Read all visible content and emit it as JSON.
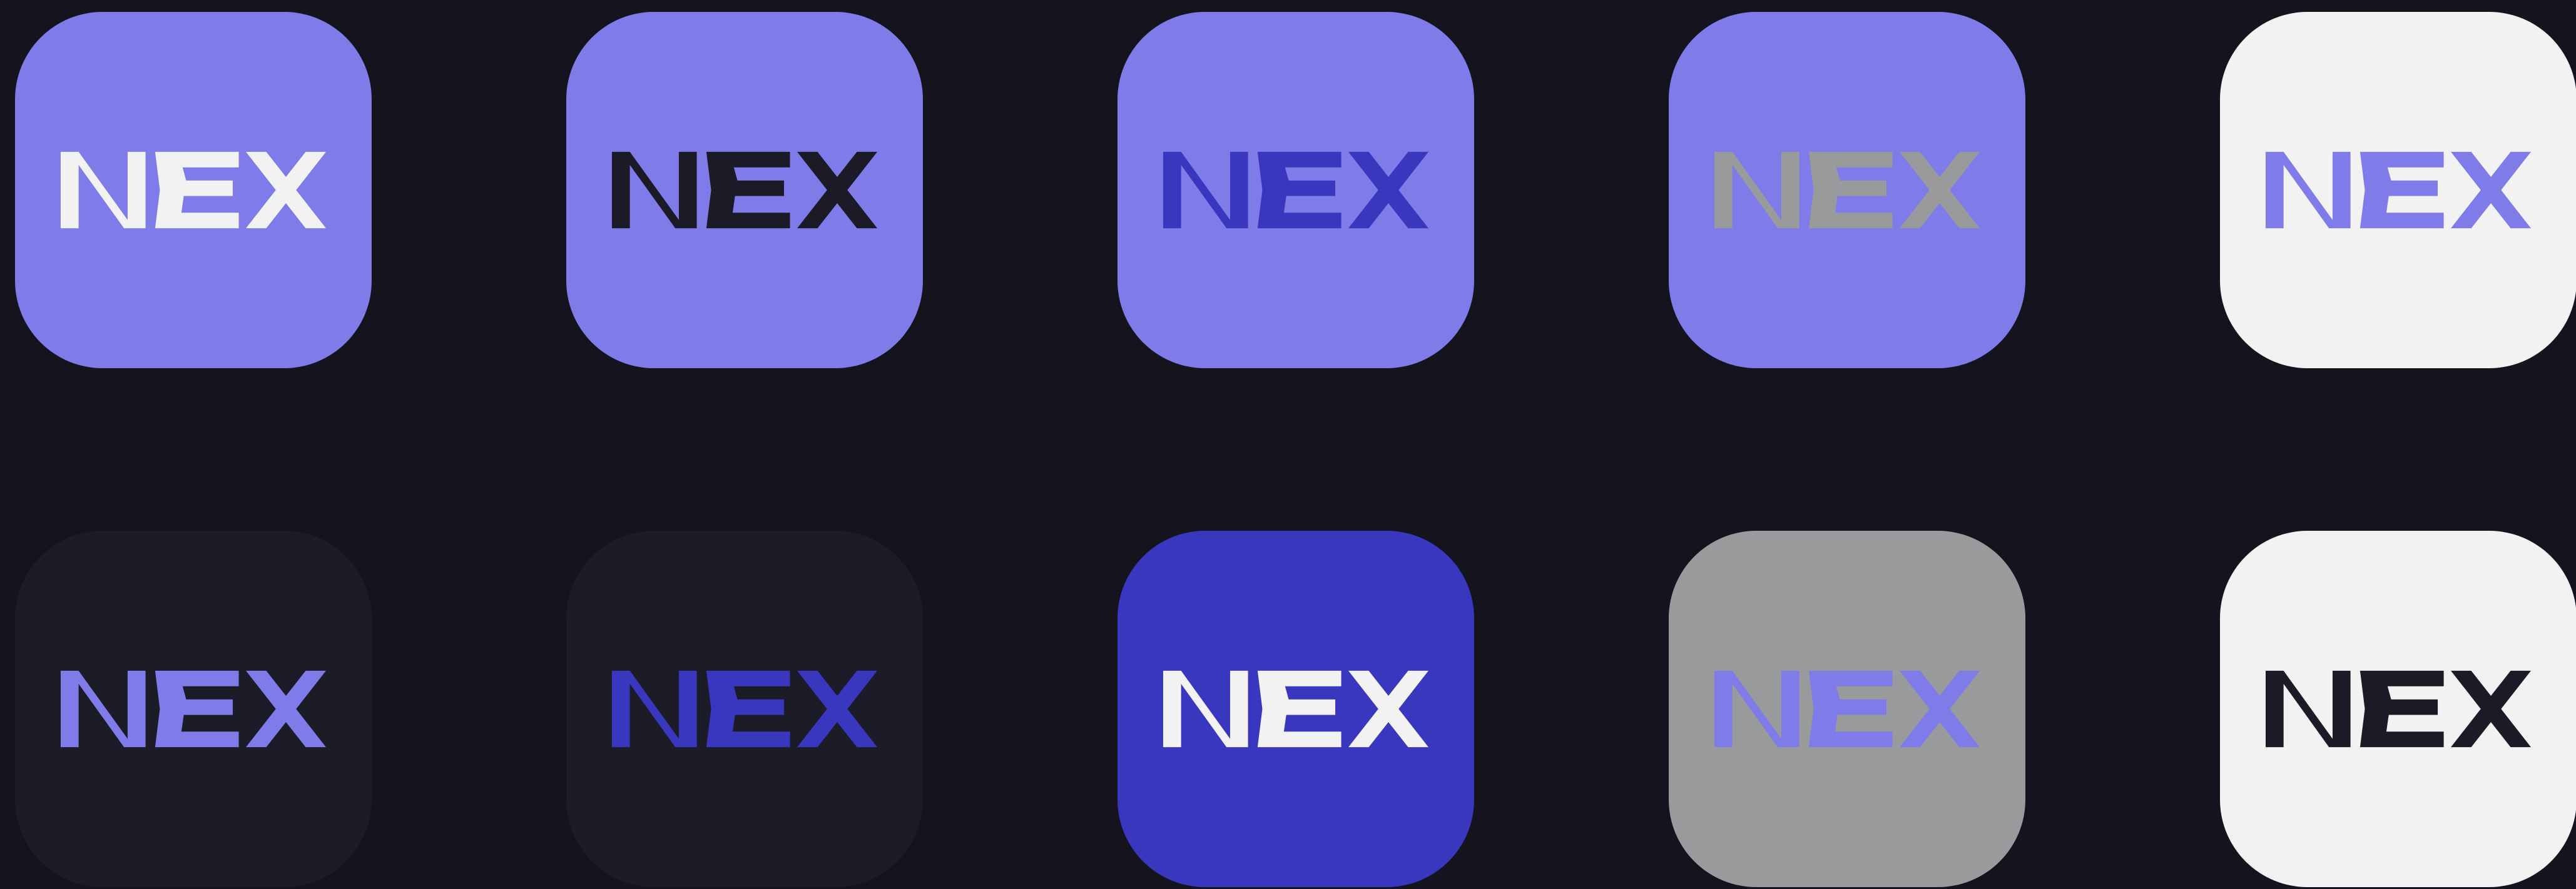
{
  "logo_text": "NEX",
  "icon_name": "nex-logo-icon",
  "palette": {
    "page_background": "#14131e",
    "lavender": "#7f7be8",
    "indigo": "#3a37bf",
    "near_black": "#1b1a26",
    "gray": "#989a9c",
    "off_white": "#f2f2f2",
    "dark_tile": "#1c1b28"
  },
  "tiles": [
    {
      "background": "#7f7be8",
      "logo_color": "#f2f2f2"
    },
    {
      "background": "#7f7be8",
      "logo_color": "#1b1a26"
    },
    {
      "background": "#7f7be8",
      "logo_color": "#3a37bf"
    },
    {
      "background": "#7f7be8",
      "logo_color": "#989a9c"
    },
    {
      "background": "#f2f2f2",
      "logo_color": "#7f7be8"
    },
    {
      "background": "#1c1b28",
      "logo_color": "#7f7be8"
    },
    {
      "background": "#1c1b28",
      "logo_color": "#3a37bf"
    },
    {
      "background": "#3a37bf",
      "logo_color": "#f2f2f2"
    },
    {
      "background": "#989a9c",
      "logo_color": "#7f7be8"
    },
    {
      "background": "#f2f2f2",
      "logo_color": "#1b1a26"
    }
  ]
}
